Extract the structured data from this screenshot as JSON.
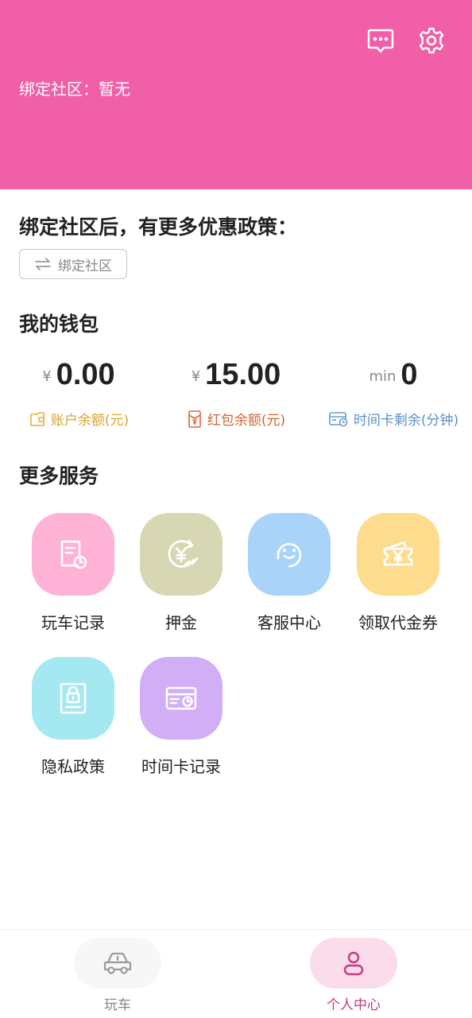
{
  "header": {
    "community_text": "绑定社区：暂无",
    "bg_color": "#f05fa7",
    "icons": [
      "message-icon",
      "gear-icon"
    ]
  },
  "promo": {
    "title": "绑定社区后，有更多优惠政策：",
    "bind_button_label": "绑定社区"
  },
  "wallet": {
    "title": "我的钱包",
    "items": [
      {
        "unit": "¥",
        "amount": "0.00",
        "label": "账户余额(元)",
        "color": "#d9a430"
      },
      {
        "unit": "¥",
        "amount": "15.00",
        "label": "红包余额(元)",
        "color": "#d4652f"
      },
      {
        "unit": "min",
        "amount": "0",
        "label": "时间卡剩余(分钟)",
        "color": "#5b8fc7"
      }
    ]
  },
  "services": {
    "title": "更多服务",
    "items": [
      {
        "label": "玩车记录",
        "icon": "record-clock-icon",
        "color": "#fdb2d6"
      },
      {
        "label": "押金",
        "icon": "deposit-yen-icon",
        "color": "#d8d7b3"
      },
      {
        "label": "客服中心",
        "icon": "headset-icon",
        "color": "#a9d3f9"
      },
      {
        "label": "领取代金券",
        "icon": "voucher-icon",
        "color": "#fddc8e"
      },
      {
        "label": "隐私政策",
        "icon": "privacy-lock-icon",
        "color": "#a4e9f1"
      },
      {
        "label": "时间卡记录",
        "icon": "time-card-icon",
        "color": "#d1aef6"
      }
    ]
  },
  "tabbar": {
    "tabs": [
      {
        "label": "玩车",
        "icon": "car-icon",
        "active": false
      },
      {
        "label": "个人中心",
        "icon": "person-icon",
        "active": true
      }
    ],
    "active_color": "#c23b84",
    "inactive_color": "#888888"
  }
}
